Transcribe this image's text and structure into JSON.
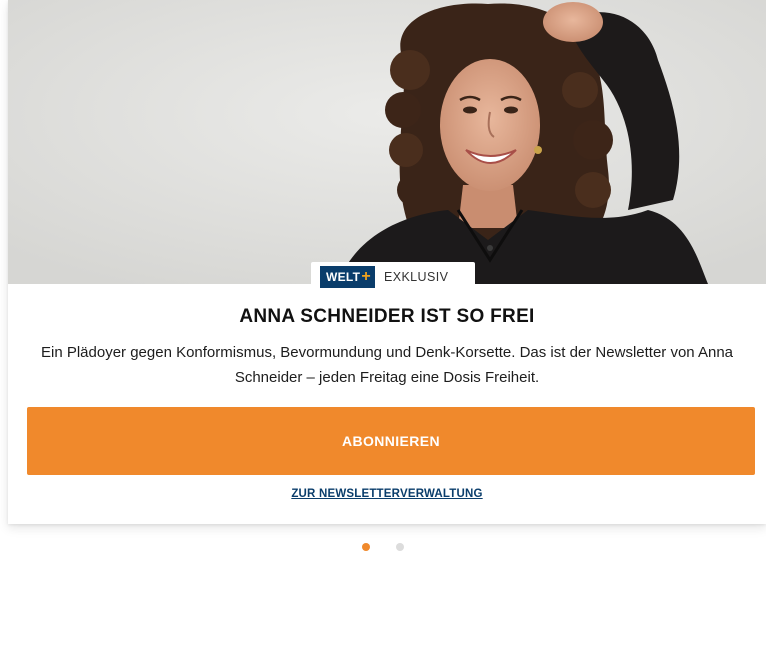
{
  "card": {
    "badge": {
      "logo_text": "WELT",
      "logo_plus": "+",
      "label": "EXKLUSIV"
    },
    "title": "ANNA SCHNEIDER IST SO FREI",
    "description": "Ein Plädoyer gegen Konformismus, Bevormundung und Denk-Korsette. Das ist der Newsletter von Anna Schneider – jeden Freitag eine Dosis Freiheit.",
    "subscribe_label": "ABONNIEREN",
    "manage_link": "ZUR NEWSLETTERVERWALTUNG"
  },
  "carousel": {
    "total": 2,
    "active_index": 0
  },
  "colors": {
    "accent": "#f0892c",
    "brand": "#0a3d6b",
    "brand_plus": "#f0a31e",
    "dot_active": "#f0892c",
    "dot_inactive": "#dcdcdc"
  }
}
